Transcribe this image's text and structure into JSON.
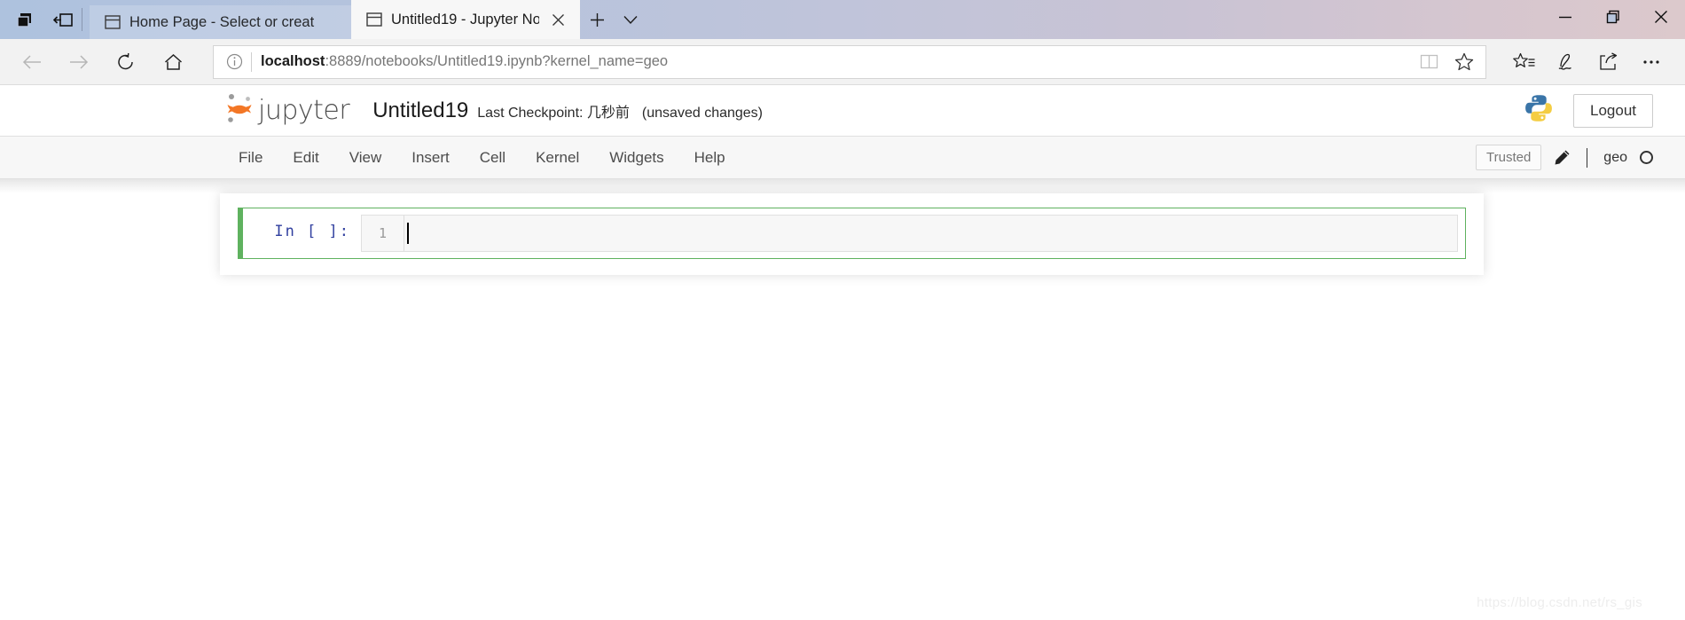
{
  "browser": {
    "window_controls": {
      "minimize": "minimize-icon",
      "restore": "restore-icon",
      "close": "close-icon"
    },
    "left_icons": [
      {
        "name": "window-stack-icon"
      },
      {
        "name": "set-aside-tabs-icon"
      }
    ],
    "tabs": [
      {
        "title": "Home Page - Select or creat",
        "active": false
      },
      {
        "title": "Untitled19 - Jupyter No",
        "active": true
      }
    ],
    "new_tab_label": "+",
    "tab_dropdown_label": "tab-list-chevron",
    "nav": {
      "back": "back-arrow-icon",
      "forward": "forward-arrow-icon",
      "refresh": "refresh-icon",
      "home": "home-icon"
    },
    "address": {
      "info_icon": "site-info-icon",
      "host": "localhost",
      "rest": ":8889/notebooks/Untitled19.ipynb?kernel_name=geo",
      "full": "localhost:8889/notebooks/Untitled19.ipynb?kernel_name=geo",
      "reading_view_icon": "book-icon",
      "favorite_icon": "star-icon"
    },
    "toolbar": {
      "favorites_hub_icon": "star-list-icon",
      "web_notes_icon": "pen-icon",
      "share_icon": "share-icon",
      "more_icon": "ellipsis-icon"
    }
  },
  "jupyter": {
    "logo": {
      "icon": "jupyter-planet-icon",
      "wordmark": "jupyter"
    },
    "notebook_name": "Untitled19",
    "checkpoint": "Last Checkpoint: 几秒前",
    "unsaved": "(unsaved changes)",
    "kernel_logo": "python-logo-icon",
    "logout_label": "Logout",
    "menu_items": [
      "File",
      "Edit",
      "View",
      "Insert",
      "Cell",
      "Kernel",
      "Widgets",
      "Help"
    ],
    "trusted_label": "Trusted",
    "edit_mode_icon": "pencil-icon",
    "kernel_name": "geo",
    "kernel_status_icon": "kernel-idle-circle-icon",
    "cells": [
      {
        "prompt": "In [ ]:",
        "line_number": "1",
        "code": "",
        "selected": true,
        "mode": "edit"
      }
    ]
  },
  "watermark": "https://blog.csdn.net/rs_gis",
  "colors": {
    "cell_edit_border": "#5fb25f",
    "prompt_blue": "#303f9f",
    "jupyter_orange": "#f37726",
    "python_blue": "#3a75a8",
    "python_yellow": "#f4cd43"
  }
}
